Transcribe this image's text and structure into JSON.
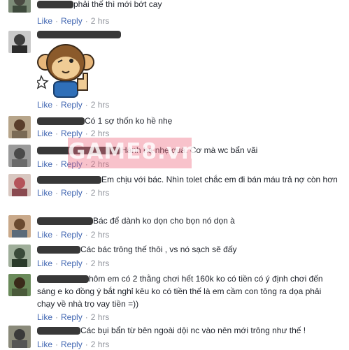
{
  "colors": {
    "link": "#4267b2",
    "meta": "#90949c",
    "text": "#1d2129",
    "watermark": "#ee6e82"
  },
  "watermark": {
    "text": "GAME8.vn"
  },
  "comments": [
    {
      "text": "phải thế thì mới bớt cay",
      "like": "Like",
      "reply": "Reply",
      "time": "2 hrs"
    },
    {
      "text": "",
      "like": "Like",
      "reply": "Reply",
      "time": "2 hrs",
      "sticker": "monkey-thumbs-up-sticker"
    },
    {
      "text": "Có 1 sợ thốn ko hề nhẹ",
      "like": "Like",
      "reply": "Reply",
      "time": "2 hrs"
    },
    {
      "text": "Hành hạ nhẹ quá. Cơ mà wc bẩn vãi",
      "like": "Like",
      "reply": "Reply",
      "time": "2 hrs"
    },
    {
      "text": "Em chịu với bác. Nhìn tolet chắc em đi bán máu trả nợ còn hơn",
      "like": "Like",
      "reply": "Reply",
      "time": "2 hrs"
    },
    {
      "text": "Bác để dành ko dọn cho bọn nó dọn à",
      "like": "Like",
      "reply": "Reply",
      "time": "2 hrs"
    },
    {
      "text": "Các bác trông thế thôi , vs nó sạch sẽ đấy",
      "like": "Like",
      "reply": "Reply",
      "time": "2 hrs"
    },
    {
      "text": "hôm em có 2 thằng chơi hết 160k ko có tiền có ý định chơi đến sáng e ko đồng ý bắt nghỉ kêu ko có tiền thế là em cầm con tông ra dọa phải chạy về nhà trọ vay tiền =))",
      "like": "Like",
      "reply": "Reply",
      "time": "2 hrs"
    },
    {
      "text": "Các bụi bẩn từ bên ngoài dội nc vào nên mới trông như thế !",
      "like": "Like",
      "reply": "Reply",
      "time": "2 hrs"
    }
  ]
}
